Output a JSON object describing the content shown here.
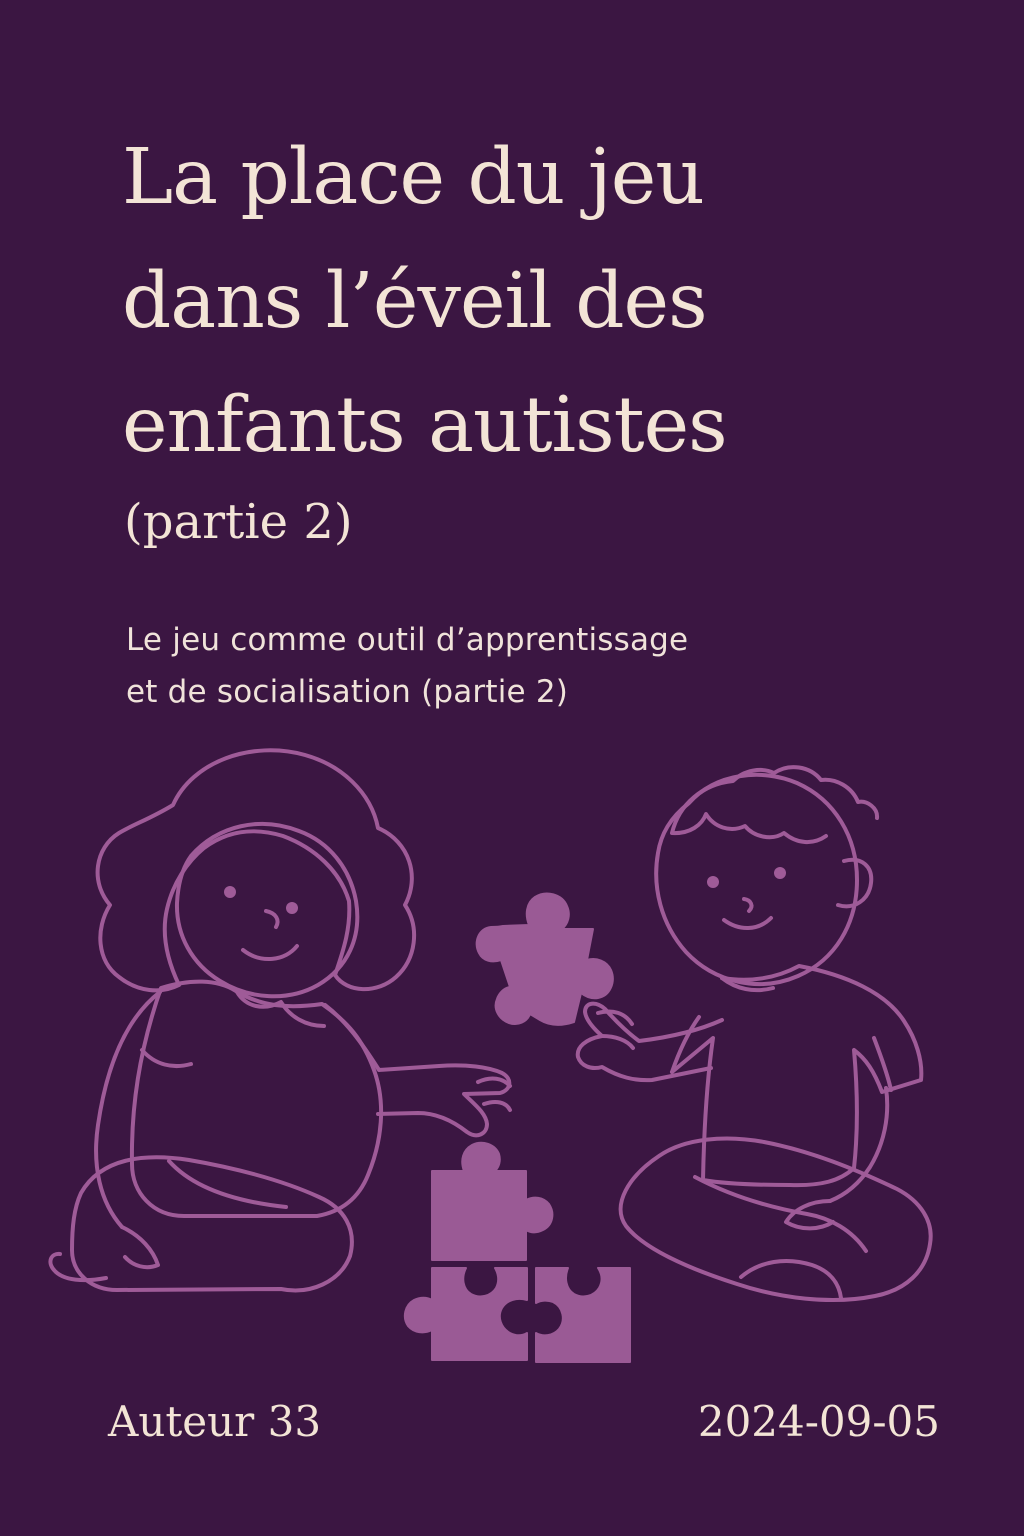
{
  "cover": {
    "title_lines": [
      "La place du jeu",
      "dans l’éveil des",
      "enfants autistes"
    ],
    "title_part": "(partie 2)",
    "subtitle_lines": [
      "Le jeu comme outil d’apprentissage",
      "et de socialisation (partie 2)"
    ],
    "author": "Auteur 33",
    "date": "2024-09-05"
  },
  "illustration": {
    "subject": "two children assembling puzzle pieces",
    "icons": [
      "girl-figure",
      "boy-figure",
      "puzzle-piece-icon"
    ]
  },
  "colors": {
    "background": "#3b1642",
    "title_text": "#f3e4d6",
    "illustration_line": "#9f5b98",
    "puzzle_fill": "#9a5a95"
  }
}
